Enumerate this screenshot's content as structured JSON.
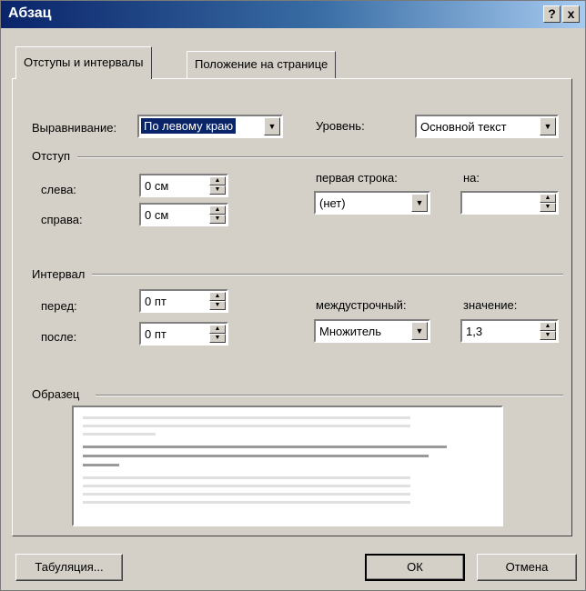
{
  "window": {
    "title": "Абзац",
    "help": "?",
    "close": "x"
  },
  "tabs": [
    "Отступы и интервалы",
    "Положение на странице"
  ],
  "general": {
    "alignment_label": "Выравнивание:",
    "alignment_value": "По левому краю",
    "level_label": "Уровень:",
    "level_value": "Основной текст"
  },
  "indent": {
    "group_label": "Отступ",
    "left_label": "слева:",
    "left_value": "0 см",
    "right_label": "справа:",
    "right_value": "0 см",
    "first_line_label": "первая строка:",
    "first_line_value": "(нет)",
    "by_label": "на:",
    "by_value": ""
  },
  "spacing": {
    "group_label": "Интервал",
    "before_label": "перед:",
    "before_value": "0 пт",
    "after_label": "после:",
    "after_value": "0 пт",
    "line_label": "междустрочный:",
    "line_value": "Множитель",
    "at_label": "значение:",
    "at_value": "1,3"
  },
  "preview": {
    "group_label": "Образец"
  },
  "buttons": {
    "tabs": "Табуляция...",
    "ok": "ОК",
    "cancel": "Отмена"
  },
  "colors": {
    "title_start": "#0a246a",
    "title_end": "#a6caf0",
    "face": "#d4d0c8"
  }
}
